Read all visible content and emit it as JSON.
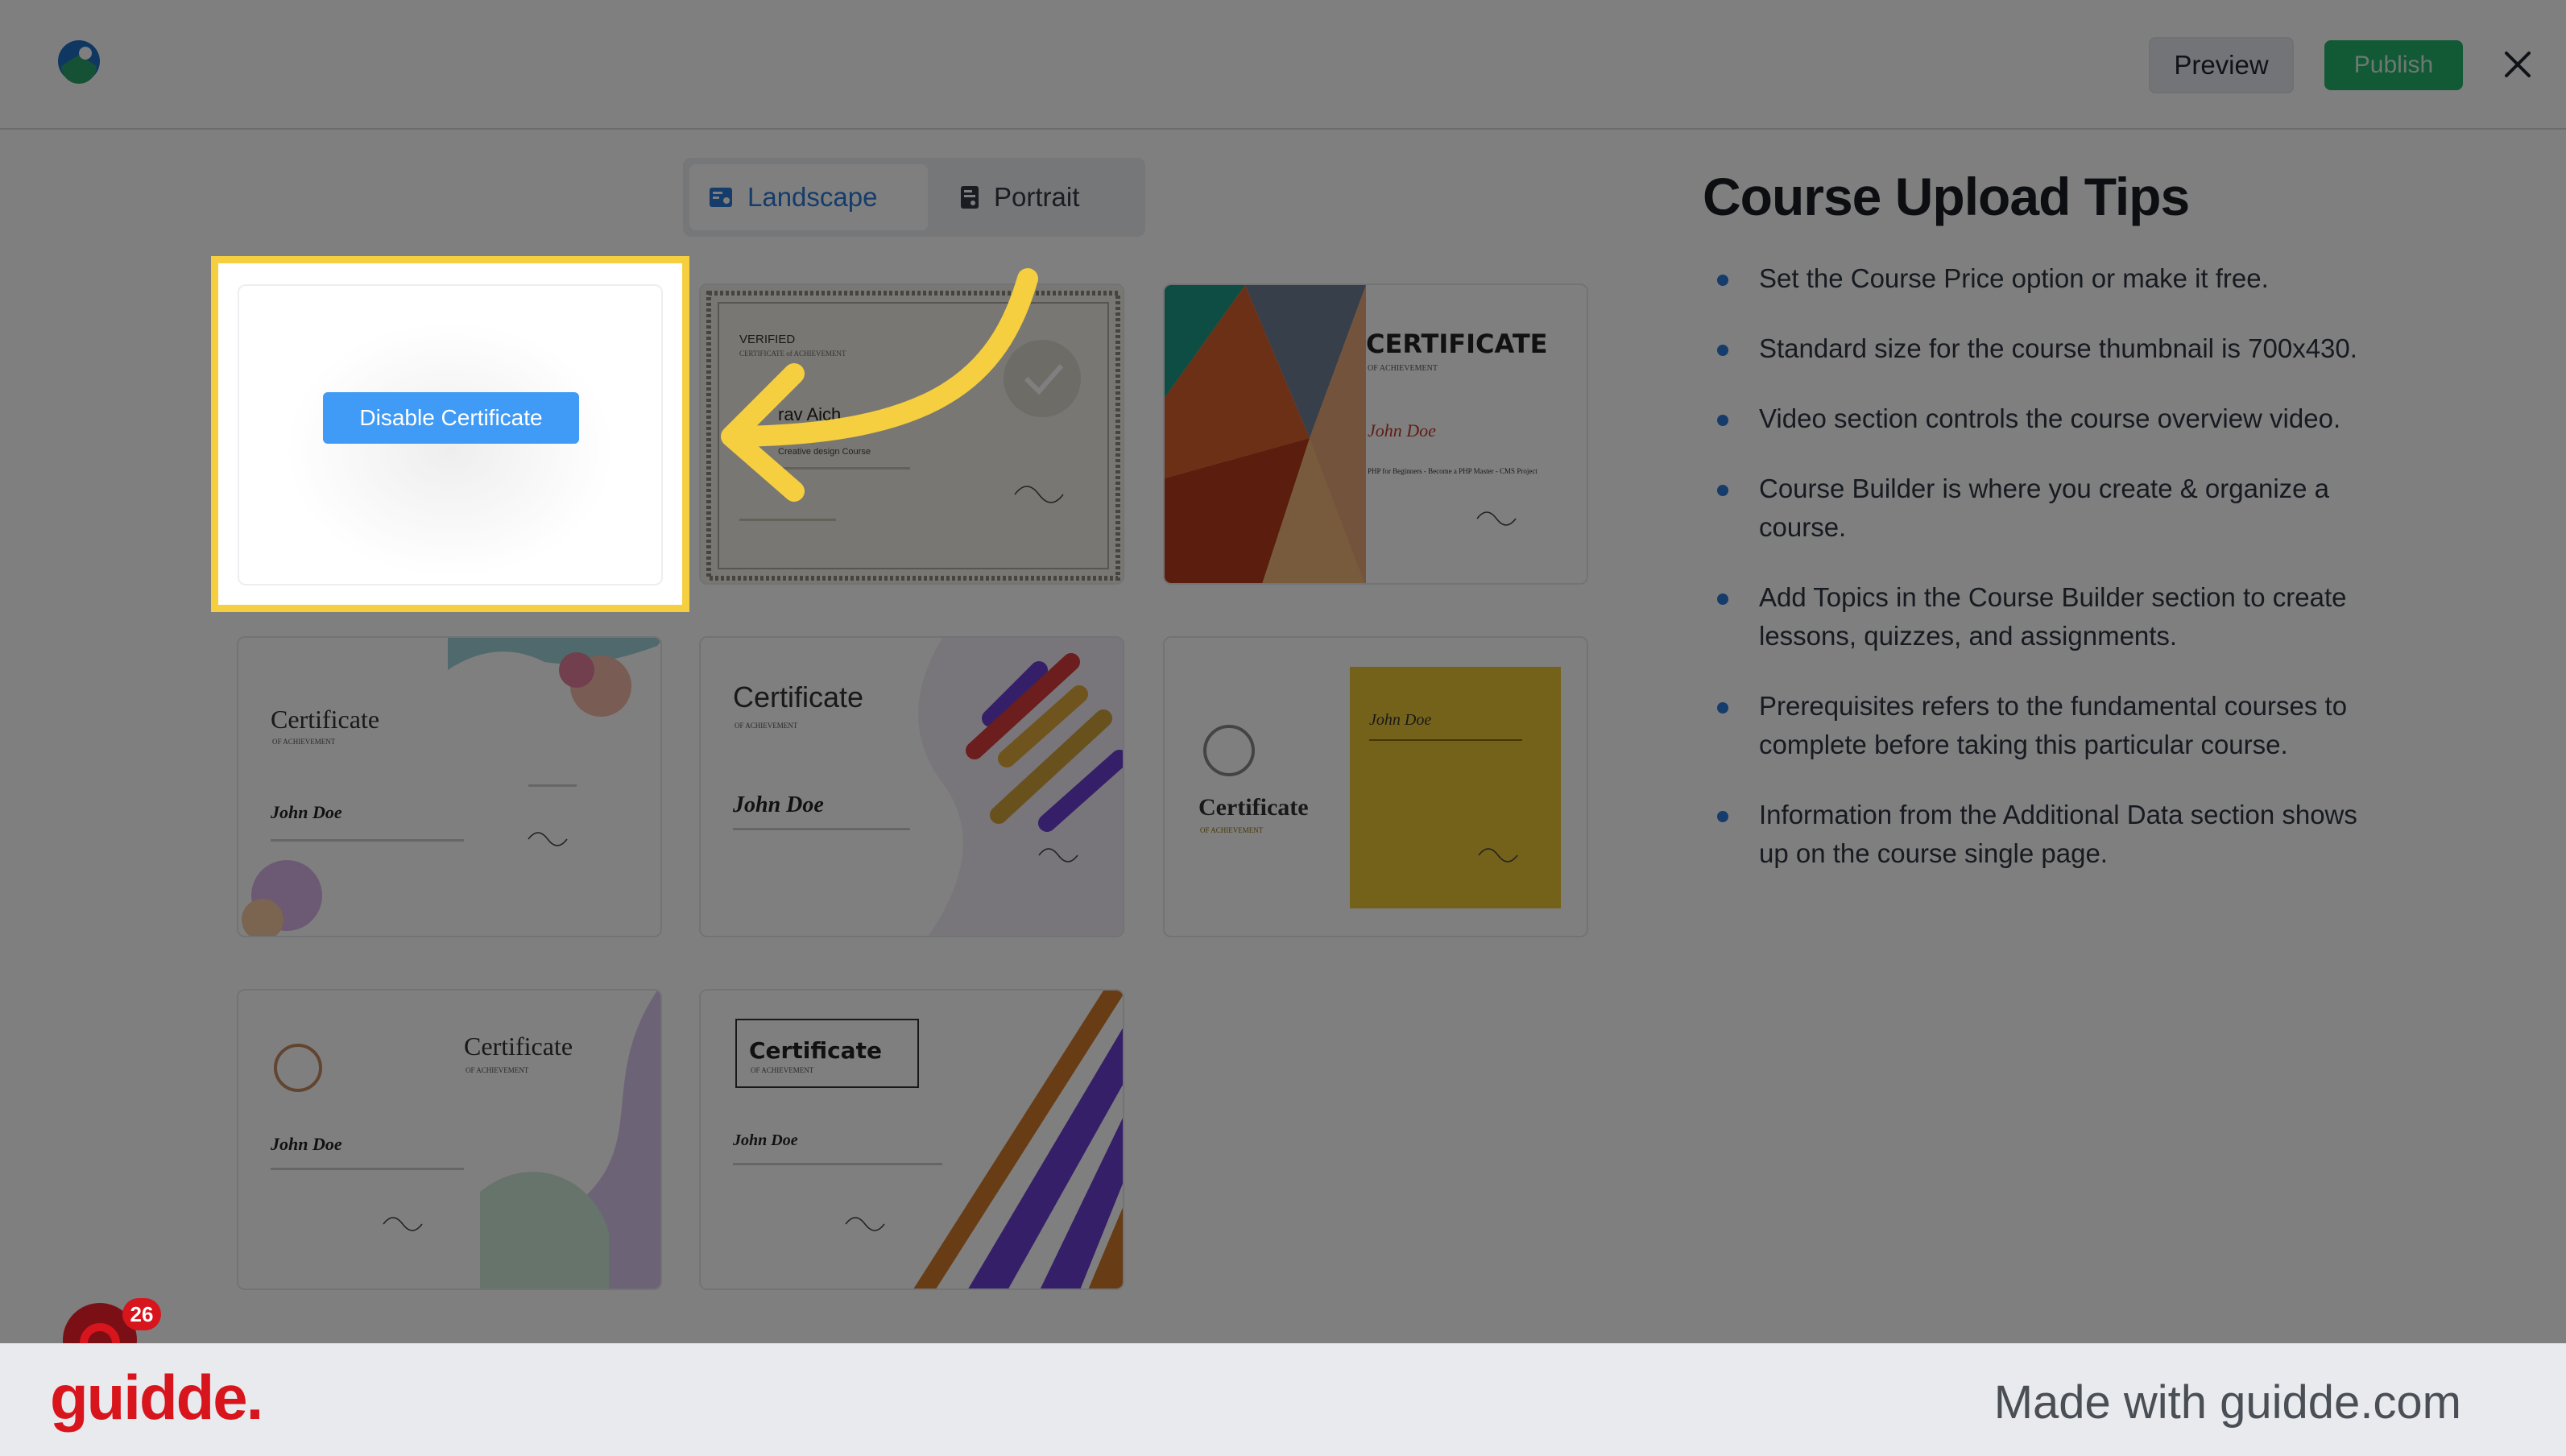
{
  "header": {
    "preview_label": "Preview",
    "publish_label": "Publish",
    "icons": {
      "logo": "app-logo-icon",
      "close": "close-icon"
    }
  },
  "orientation": {
    "tabs": [
      {
        "label": "Landscape",
        "icon": "landscape-icon",
        "active": true
      },
      {
        "label": "Portrait",
        "icon": "portrait-icon",
        "active": false
      }
    ]
  },
  "templates": {
    "disable_label": "Disable Certificate",
    "t2": {
      "verified": "VERIFIED",
      "sub": "CERTIFICATE of ACHIEVEMENT",
      "name": "rav Aich",
      "course": "Creative design Course"
    },
    "t3": {
      "title": "CERTIFICATE",
      "sub": "OF ACHIEVEMENT",
      "name": "John Doe",
      "course": "PHP for Beginners - Become a PHP Master - CMS Project"
    },
    "t4": {
      "title": "Certificate",
      "sub": "OF ACHIEVEMENT",
      "name": "John Doe"
    },
    "t5": {
      "title": "Certificate",
      "sub": "OF ACHIEVEMENT",
      "name": "John Doe"
    },
    "t6": {
      "title": "Certificate",
      "sub": "OF ACHIEVEMENT",
      "name": "John Doe"
    },
    "t7": {
      "title": "Certificate",
      "sub": "OF ACHIEVEMENT",
      "name": "John Doe"
    },
    "t8": {
      "title": "Certificate",
      "sub": "OF ACHIEVEMENT",
      "name": "John Doe"
    }
  },
  "tips": {
    "title": "Course Upload Tips",
    "items": [
      "Set the Course Price option or make it free.",
      "Standard size for the course thumbnail is 700x430.",
      "Video section controls the course overview video.",
      "Course Builder is where you create & organize a course.",
      "Add Topics in the Course Builder section to create lessons, quizzes, and assignments.",
      "Prerequisites refers to the fundamental courses to complete before taking this particular course.",
      "Information from the Additional Data section shows up on the course single page."
    ]
  },
  "footer": {
    "brand": "guidde.",
    "made_with": "Made with guidde.com",
    "badge_count": "26"
  },
  "colors": {
    "highlight": "#f5cf3f",
    "arrow": "#f5cf3f",
    "accent": "#2a78d6",
    "publish": "#24b26b",
    "brand": "#d8141c"
  }
}
